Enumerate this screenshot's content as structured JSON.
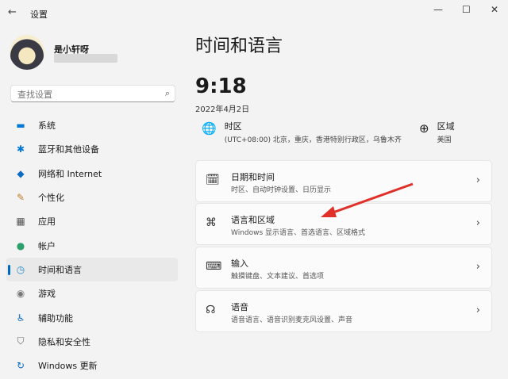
{
  "window": {
    "title": "设置",
    "back": "←",
    "minimize": "—",
    "maximize": "☐",
    "close": "✕"
  },
  "user": {
    "name": "是小轩呀"
  },
  "search": {
    "placeholder": "查找设置",
    "icon": "⌕"
  },
  "nav": [
    {
      "label": "系统",
      "icon": "▬",
      "color": "#0078d4"
    },
    {
      "label": "蓝牙和其他设备",
      "icon": "✱",
      "color": "#0078d4"
    },
    {
      "label": "网络和 Internet",
      "icon": "◆",
      "color": "#0a6cc4"
    },
    {
      "label": "个性化",
      "icon": "✎",
      "color": "#c57a2a"
    },
    {
      "label": "应用",
      "icon": "▦",
      "color": "#555"
    },
    {
      "label": "帐户",
      "icon": "●",
      "color": "#2aa06a"
    },
    {
      "label": "时间和语言",
      "icon": "◷",
      "color": "#1e88c8"
    },
    {
      "label": "游戏",
      "icon": "◉",
      "color": "#777"
    },
    {
      "label": "辅助功能",
      "icon": "♿",
      "color": "#1a6fc0"
    },
    {
      "label": "隐私和安全性",
      "icon": "⛉",
      "color": "#666"
    },
    {
      "label": "Windows 更新",
      "icon": "↻",
      "color": "#0a6cc4"
    }
  ],
  "page": {
    "title": "时间和语言",
    "time": "9:18",
    "date": "2022年4月2日",
    "timezone": {
      "label": "时区",
      "value": "(UTC+08:00) 北京，重庆，香港特别行政区，乌鲁木齐"
    },
    "region": {
      "label": "区域",
      "value": "美国"
    },
    "cards": [
      {
        "title": "日期和时间",
        "sub": "时区、自动时钟设置、日历显示",
        "icon": "🗓"
      },
      {
        "title": "语言和区域",
        "sub": "Windows 显示语言、首选语言、区域格式",
        "icon": "⌘"
      },
      {
        "title": "输入",
        "sub": "触摸键盘、文本建议、首选项",
        "icon": "⌨"
      },
      {
        "title": "语音",
        "sub": "语音语言、语音识别麦克风设置、声音",
        "icon": "☊"
      }
    ]
  },
  "annotation_color": "#e0302a"
}
